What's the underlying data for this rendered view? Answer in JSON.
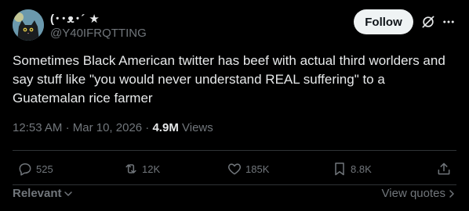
{
  "author": {
    "display_name": "(･･ᴥ･´ ★",
    "handle": "@Y40IFRQTTING"
  },
  "header": {
    "follow_label": "Follow"
  },
  "tweet": {
    "text": "Sometimes Black American twitter has beef with actual third worlders and say stuff like \"you would never understand REAL suffering\" to a Guatemalan rice farmer",
    "time": "12:53 AM",
    "date": "Mar 10, 2026",
    "separator": "·",
    "views_count": "4.9M",
    "views_label": "Views"
  },
  "actions": {
    "replies": "525",
    "reposts": "12K",
    "likes": "185K",
    "bookmarks": "8.8K"
  },
  "footer": {
    "sort_label": "Relevant",
    "view_quotes_label": "View quotes"
  },
  "icons": {
    "avatar": "cat-avatar",
    "grok": "grok-icon",
    "more": "more-icon",
    "reply": "reply-icon",
    "repost": "repost-icon",
    "like": "like-icon",
    "bookmark": "bookmark-icon",
    "share": "share-icon"
  },
  "colors": {
    "background": "#000000",
    "text_primary": "#e7e9ea",
    "text_secondary": "#71767b",
    "divider": "#2f3336",
    "follow_button_bg": "#eff3f4"
  }
}
